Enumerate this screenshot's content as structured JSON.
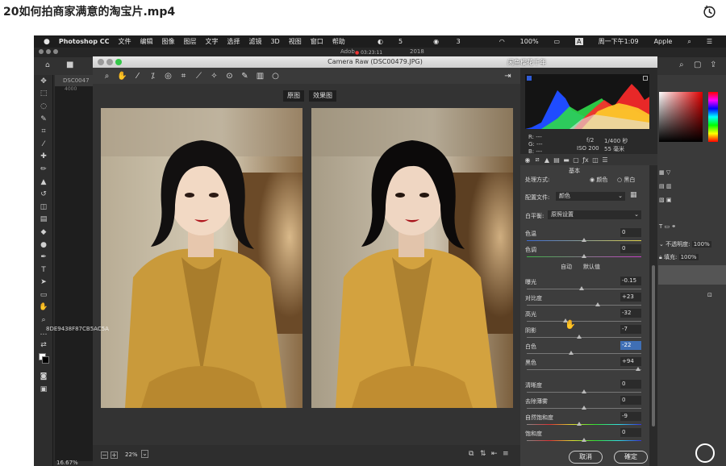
{
  "page": {
    "title": "20如何拍商家满意的淘宝片.mp4"
  },
  "macbar": {
    "apple": "",
    "app_name": "Photoshop CC",
    "menus": [
      "文件",
      "编辑",
      "图像",
      "图层",
      "文字",
      "选择",
      "滤镜",
      "3D",
      "视图",
      "窗口",
      "帮助"
    ],
    "status": {
      "badge1": "5",
      "badge2": "3",
      "battery": "100%",
      "input": "A",
      "clock": "周一下午1:09",
      "account": "Apple"
    }
  },
  "ps": {
    "row2_text": "Adob",
    "timer": "03:23:11",
    "year": "2018",
    "doc_tab": "DSC0047",
    "doc_ruler": "4000",
    "zoom_status": "16.67%",
    "overlay_id": "8DE9438F87CB5AC5A",
    "watermark": "闲鱼樱花千年",
    "right_panel": {
      "opacity_label": "不透明度:",
      "opacity_value": "100%",
      "fill_label": "填充:",
      "fill_value": "100%"
    }
  },
  "camera_raw": {
    "title": "Camera Raw (DSC00479.JPG)",
    "view_tabs": {
      "original": "原图",
      "after": "效果图"
    },
    "zoom": "22%",
    "histogram": {
      "r": "R:  ---",
      "g": "G:  ---",
      "b": "B:  ---",
      "aperture": "f/2",
      "shutter": "1/400 秒",
      "iso": "ISO 200",
      "focal": "55 毫米"
    },
    "panel": {
      "section": "基本",
      "treatment_label": "处理方式:",
      "treatment_color": "颜色",
      "treatment_bw": "黑白",
      "profile_label": "配置文件:",
      "profile_value": "颜色",
      "wb_label": "白平衡:",
      "wb_value": "原照设置",
      "auto": "自动",
      "default": "默认值"
    },
    "sliders": [
      {
        "label": "色温",
        "value": "0",
        "pos": 0.5
      },
      {
        "label": "色调",
        "value": "0",
        "pos": 0.5
      },
      {
        "label": "曝光",
        "value": "-0.15",
        "pos": 0.48
      },
      {
        "label": "对比度",
        "value": "+23",
        "pos": 0.62
      },
      {
        "label": "高光",
        "value": "-32",
        "pos": 0.34
      },
      {
        "label": "阴影",
        "value": "-7",
        "pos": 0.46
      },
      {
        "label": "白色",
        "value": "-22",
        "pos": 0.39,
        "active": true
      },
      {
        "label": "黑色",
        "value": "+94",
        "pos": 0.97
      },
      {
        "label": "清晰度",
        "value": "0",
        "pos": 0.5
      },
      {
        "label": "去除薄雾",
        "value": "0",
        "pos": 0.5
      },
      {
        "label": "自然饱和度",
        "value": "-9",
        "pos": 0.46
      },
      {
        "label": "饱和度",
        "value": "0",
        "pos": 0.5
      }
    ],
    "buttons": {
      "cancel": "取消",
      "ok": "確定"
    }
  }
}
